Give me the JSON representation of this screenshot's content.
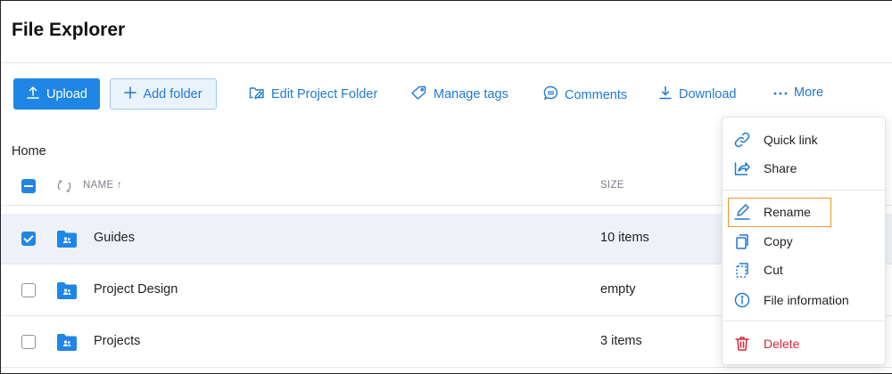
{
  "app": {
    "title": "File Explorer"
  },
  "toolbar": {
    "upload_label": "Upload",
    "add_folder_label": "Add folder",
    "edit_project_folder_label": "Edit Project Folder",
    "manage_tags_label": "Manage tags",
    "comments_label": "Comments",
    "download_label": "Download",
    "more_label": "More"
  },
  "breadcrumb": {
    "home": "Home"
  },
  "table": {
    "columns": {
      "name": "NAME ↑",
      "size": "SIZE"
    },
    "rows": [
      {
        "name": "Guides",
        "size": "10 items",
        "selected": true
      },
      {
        "name": "Project Design",
        "size": "empty",
        "selected": false
      },
      {
        "name": "Projects",
        "size": "3 items",
        "selected": false
      }
    ]
  },
  "menu": {
    "quick_link": "Quick link",
    "share": "Share",
    "rename": "Rename",
    "copy": "Copy",
    "cut": "Cut",
    "file_information": "File information",
    "delete": "Delete"
  },
  "colors": {
    "accent": "#1f86e6",
    "link": "#1f78d1",
    "danger": "#d9263a",
    "highlight": "#f0962b",
    "selected_row": "#eef2f8"
  },
  "icons": {
    "upload": "upload-icon",
    "add": "plus-icon",
    "edit_folder": "folder-edit-icon",
    "tags": "tag-icon",
    "comments": "comment-icon",
    "download": "download-icon",
    "more": "ellipsis-icon",
    "folder": "shared-folder-icon",
    "quick_link": "link-icon",
    "share": "share-icon",
    "rename": "pencil-icon",
    "copy": "copy-icon",
    "cut": "cut-icon",
    "file_information": "info-icon",
    "delete": "trash-icon"
  }
}
